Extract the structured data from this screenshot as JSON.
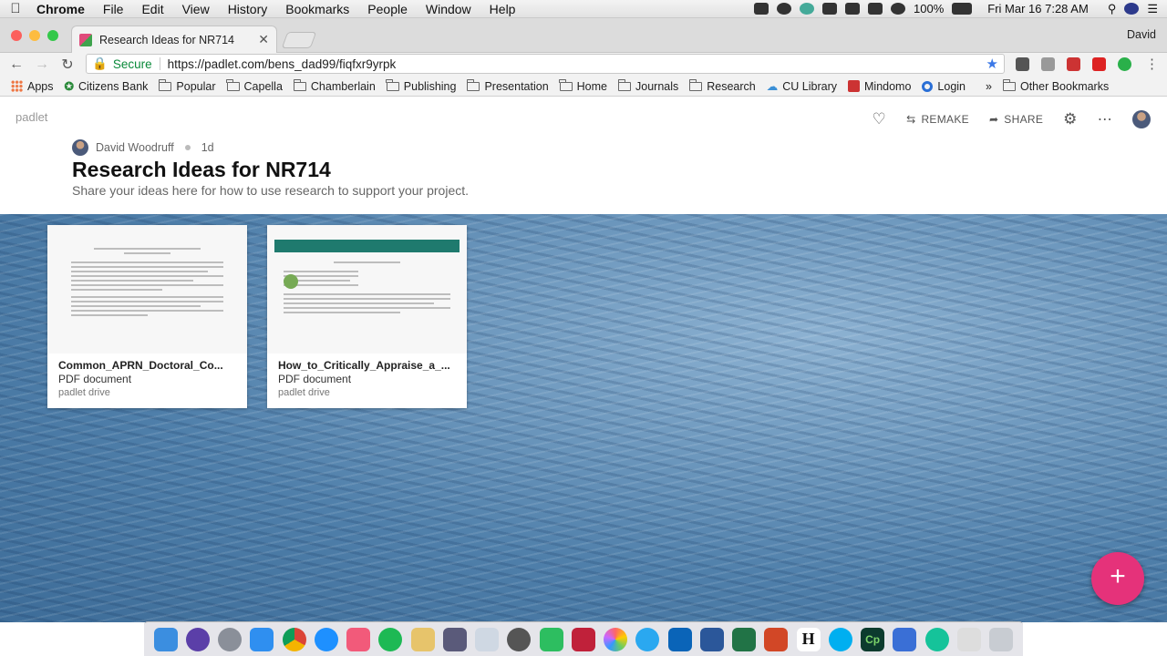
{
  "menubar": {
    "app": "Chrome",
    "items": [
      "File",
      "Edit",
      "View",
      "History",
      "Bookmarks",
      "People",
      "Window",
      "Help"
    ],
    "battery": "100%",
    "datetime": "Fri Mar 16  7:28 AM"
  },
  "browser": {
    "tab_title": "Research Ideas for NR714",
    "user": "David",
    "secure_label": "Secure",
    "url": "https://padlet.com/bens_dad99/fiqfxr9yrpk",
    "bookmarks": [
      "Apps",
      "Citizens Bank",
      "Popular",
      "Capella",
      "Chamberlain",
      "Publishing",
      "Presentation",
      "Home",
      "Journals",
      "Research",
      "CU Library",
      "Mindomo",
      "Login"
    ],
    "overflow": "»",
    "other_bookmarks": "Other Bookmarks"
  },
  "padlet": {
    "logo": "padlet",
    "remake": "REMAKE",
    "share": "SHARE",
    "author": "David Woodruff",
    "age": "1d",
    "title": "Research Ideas for NR714",
    "description": "Share your ideas here for how to use research to support your project.",
    "posts": [
      {
        "name": "Common_APRN_Doctoral_Co...",
        "type": "PDF document",
        "source": "padlet drive"
      },
      {
        "name": "How_to_Critically_Appraise_a_...",
        "type": "PDF document",
        "source": "padlet drive"
      }
    ],
    "add_button": "+"
  },
  "colors": {
    "accent": "#e5327a",
    "secure": "#0a8a3a"
  }
}
